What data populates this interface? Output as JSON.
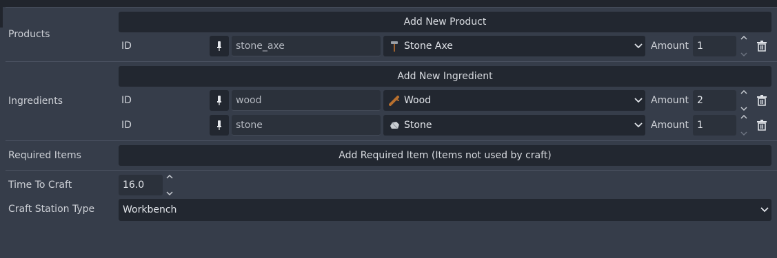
{
  "sections": {
    "products": {
      "label": "Products",
      "add_button": "Add New Product",
      "rows": [
        {
          "id_label": "ID",
          "id_value": "stone_axe",
          "item_name": "Stone Axe",
          "item_icon": "axe-icon",
          "amount_label": "Amount",
          "amount": "1"
        }
      ]
    },
    "ingredients": {
      "label": "Ingredients",
      "add_button": "Add New Ingredient",
      "rows": [
        {
          "id_label": "ID",
          "id_value": "wood",
          "item_name": "Wood",
          "item_icon": "wood-icon",
          "amount_label": "Amount",
          "amount": "2"
        },
        {
          "id_label": "ID",
          "id_value": "stone",
          "item_name": "Stone",
          "item_icon": "stone-icon",
          "amount_label": "Amount",
          "amount": "1"
        }
      ]
    },
    "required_items": {
      "label": "Required Items",
      "add_button": "Add Required Item (Items not used by craft)"
    }
  },
  "time_to_craft": {
    "label": "Time To Craft",
    "value": "16.0"
  },
  "craft_station": {
    "label": "Craft Station Type",
    "value": "Workbench"
  },
  "colors": {
    "background": "#363d4a",
    "button_bg": "#222730",
    "field_bg": "#2b313b",
    "separator": "#4a5160",
    "text": "#cdd0d6"
  }
}
